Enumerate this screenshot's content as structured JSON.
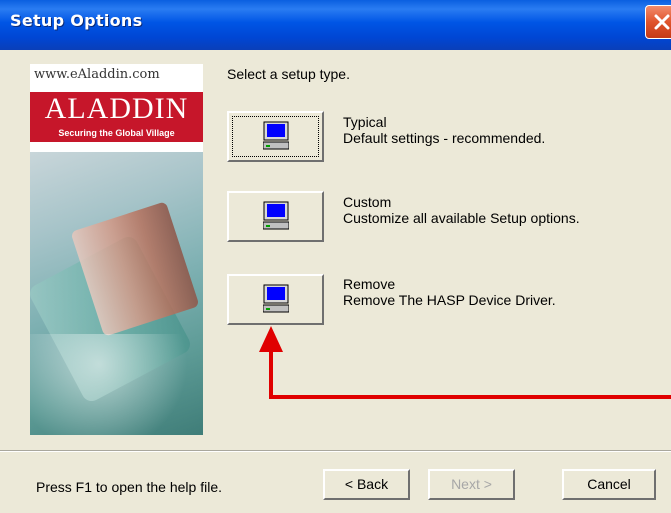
{
  "window": {
    "title": "Setup Options"
  },
  "banner": {
    "url": "www.eAladdin.com",
    "logo": "ALADDIN",
    "tagline": "Securing the Global Village"
  },
  "main": {
    "prompt": "Select a setup type.",
    "options": [
      {
        "label": "Typical",
        "description": "Default settings - recommended.",
        "icon": "computer-icon"
      },
      {
        "label": "Custom",
        "description": "Customize all available Setup options.",
        "icon": "computer-icon"
      },
      {
        "label": "Remove",
        "description": "Remove The HASP Device Driver.",
        "icon": "computer-icon"
      }
    ]
  },
  "footer": {
    "help_text": "Press F1 to open the help file.",
    "back_label": "< Back",
    "next_label": "Next >",
    "cancel_label": "Cancel"
  },
  "colors": {
    "title_bar": "#0055e5",
    "arrow": "#e00000",
    "dialog_bg": "#ece9d8"
  }
}
